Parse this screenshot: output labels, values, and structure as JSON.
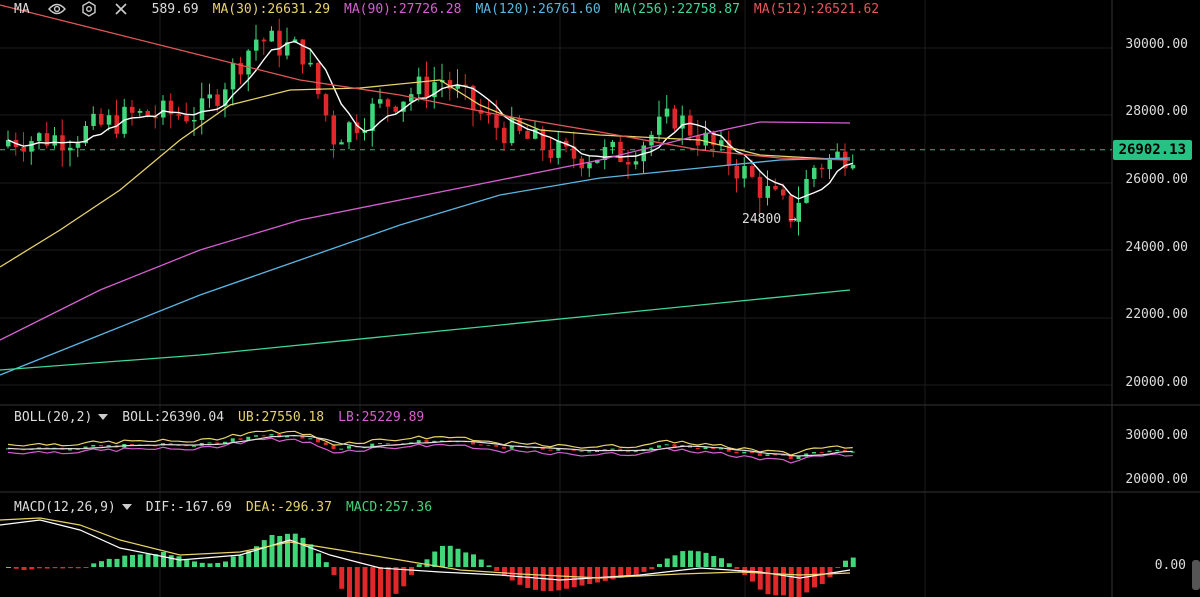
{
  "main_legend": {
    "indicator": "MA",
    "clipped_value": "589.69",
    "items": [
      {
        "label": "MA(30):26631.29",
        "color": "#e8d36a"
      },
      {
        "label": "MA(90):27726.28",
        "color": "#d65fd1"
      },
      {
        "label": "MA(120):26761.60",
        "color": "#5ab7e2"
      },
      {
        "label": "MA(256):22758.87",
        "color": "#3fd79a"
      },
      {
        "label": "MA(512):26521.62",
        "color": "#e45757"
      }
    ]
  },
  "boll_legend": {
    "indicator": "BOLL(20,2)",
    "items": [
      {
        "label": "BOLL:26390.04",
        "color": "#dddddd"
      },
      {
        "label": "UB:27550.18",
        "color": "#e8d36a"
      },
      {
        "label": "LB:25229.89",
        "color": "#d65fd1"
      }
    ]
  },
  "macd_legend": {
    "indicator": "MACD(12,26,9)",
    "items": [
      {
        "label": "DIF:-167.69",
        "color": "#dddddd"
      },
      {
        "label": "DEA:-296.37",
        "color": "#e8d36a"
      },
      {
        "label": "MACD:257.36",
        "color": "#3fd779"
      }
    ]
  },
  "price_axis": [
    "30000.00",
    "28000.00",
    "26000.00",
    "24000.00",
    "22000.00",
    "20000.00"
  ],
  "boll_axis": [
    "30000.00",
    "20000.00"
  ],
  "macd_axis": [
    "0.00"
  ],
  "last_price": "26902.13",
  "low_annotation": "24800",
  "low_arrow": "→",
  "colors": {
    "up": "#3fd779",
    "down": "#e0282a",
    "grid": "#1c1c1c",
    "current_line": "#26c283"
  }
}
